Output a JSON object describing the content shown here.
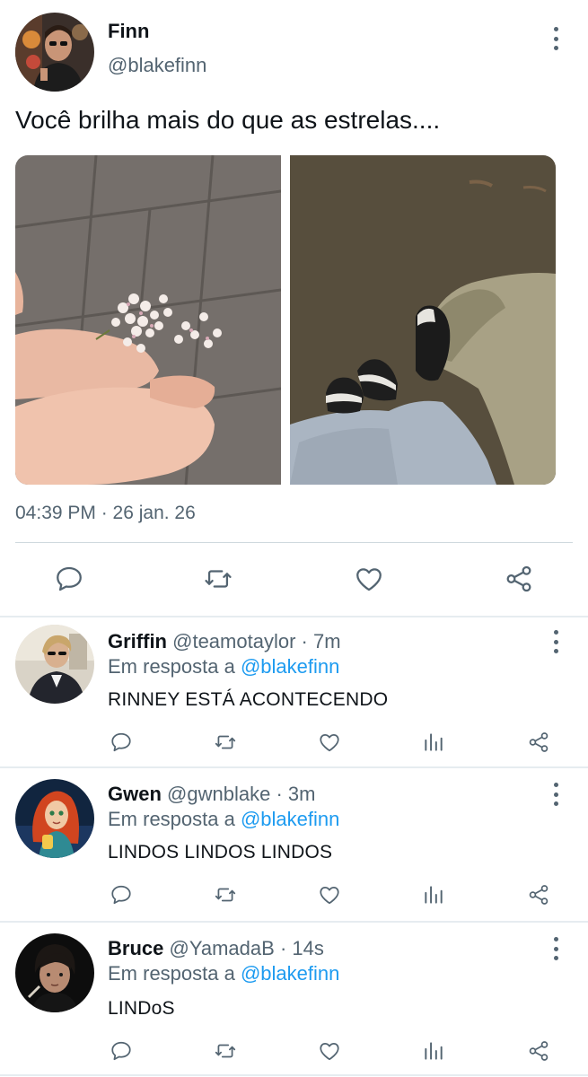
{
  "main_tweet": {
    "name": "Finn",
    "handle": "@blakefinn",
    "text": "Você brilha mais do que as estrelas....",
    "timestamp": "04:39 PM · 26 jan. 26",
    "actions": [
      "comment-icon",
      "retweet-icon",
      "like-icon",
      "share-icon"
    ]
  },
  "replies": [
    {
      "name": "Griffin",
      "handle": "@teamotaylor",
      "dot": "·",
      "time": "7m",
      "reply_prefix": "Em resposta a",
      "reply_to": "@blakefinn",
      "text": "RINNEY ESTÁ ACONTECENDO"
    },
    {
      "name": "Gwen",
      "handle": "@gwnblake",
      "dot": "·",
      "time": "3m",
      "reply_prefix": "Em resposta a",
      "reply_to": "@blakefinn",
      "text": "LINDOS LINDOS LINDOS"
    },
    {
      "name": "Bruce",
      "handle": "@YamadaB",
      "dot": "·",
      "time": "14s",
      "reply_prefix": "Em resposta a",
      "reply_to": "@blakefinn",
      "text": "LINDoS"
    }
  ],
  "colors": {
    "text": "#0f1419",
    "secondary": "#536471",
    "link": "#1d9bf0",
    "divider": "#cfd9de"
  }
}
